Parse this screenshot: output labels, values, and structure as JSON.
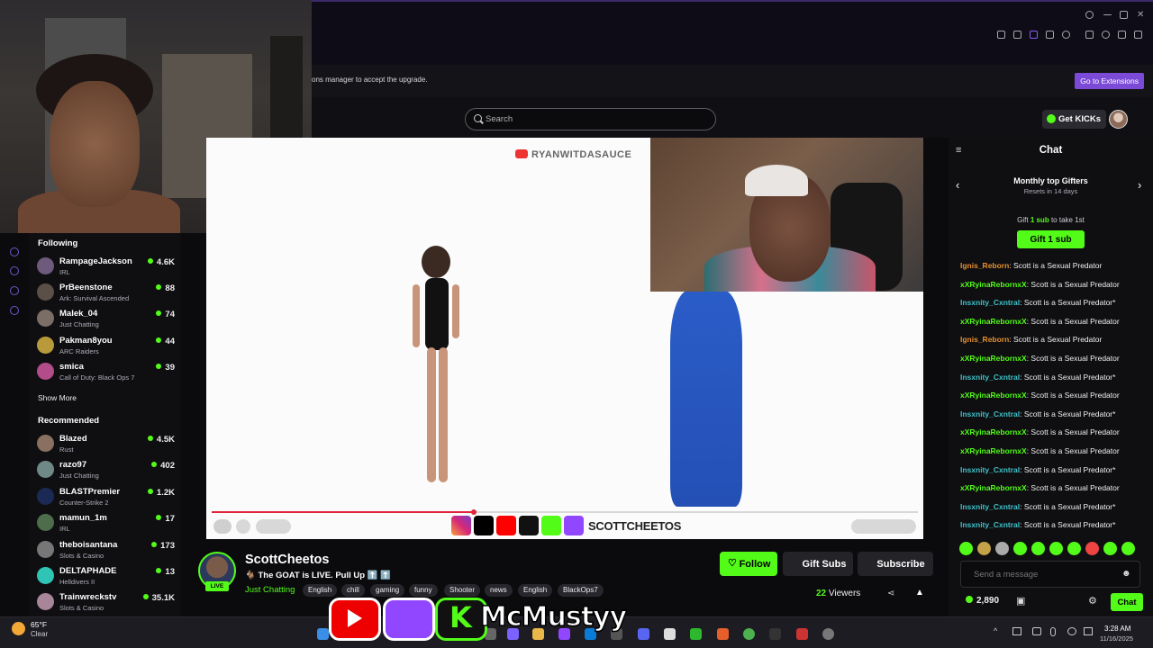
{
  "extension_bar": {
    "message": "ons manager to accept the upgrade.",
    "button_label": "Go to Extensions"
  },
  "header": {
    "search_placeholder": "Search",
    "get_kicks_label": "Get KICKs"
  },
  "sidebar": {
    "following_title": "Following",
    "following": [
      {
        "name": "RampageJackson",
        "category": "IRL",
        "viewers": "4.6K"
      },
      {
        "name": "PrBeenstone",
        "category": "Ark: Survival Ascended",
        "viewers": "88"
      },
      {
        "name": "Malek_04",
        "category": "Just Chatting",
        "viewers": "74"
      },
      {
        "name": "Pakman8you",
        "category": "ARC Raiders",
        "viewers": "44"
      },
      {
        "name": "smica",
        "category": "Call of Duty: Black Ops 7",
        "viewers": "39"
      }
    ],
    "show_more": "Show More",
    "recommended_title": "Recommended",
    "recommended": [
      {
        "name": "Blazed",
        "category": "Rust",
        "viewers": "4.5K"
      },
      {
        "name": "razo97",
        "category": "Just Chatting",
        "viewers": "402"
      },
      {
        "name": "BLASTPremier",
        "category": "Counter-Strike 2",
        "viewers": "1.2K"
      },
      {
        "name": "mamun_1m",
        "category": "IRL",
        "viewers": "17"
      },
      {
        "name": "theboisantana",
        "category": "Slots & Casino",
        "viewers": "173"
      },
      {
        "name": "DELTAPHADE",
        "category": "Helldivers II",
        "viewers": "13"
      },
      {
        "name": "Trainwreckstv",
        "category": "Slots & Casino",
        "viewers": "35.1K"
      }
    ]
  },
  "video": {
    "watermark": "RYANWITDASAUCE",
    "social_handle": "SCOTTCHEETOS",
    "progress_fraction": 0.37
  },
  "stream": {
    "streamer_name": "ScottCheetos",
    "title": "🐐 The GOAT is LIVE. Pull Up ⬆️ ⬆️",
    "category": "Just Chatting",
    "tags": [
      "English",
      "chill",
      "gaming",
      "funny",
      "Shooter",
      "news",
      "English",
      "BlackOps7"
    ],
    "live_label": "LIVE",
    "follow_label": "Follow",
    "gift_subs_label": "Gift Subs",
    "subscribe_label": "Subscribe",
    "viewers_count": "22",
    "viewers_label": "Viewers"
  },
  "chat": {
    "title": "Chat",
    "gifters_title": "Monthly top Gifters",
    "gifters_sub": "Resets in 14 days",
    "gift_note_pre": "Gift",
    "gift_note_highlight": "1 sub",
    "gift_note_post": "to take 1st",
    "gift_button": "Gift 1 sub",
    "messages": [
      {
        "user": "Ignis_Reborn",
        "color": "#e6902e",
        "text": ": Scott is a Sexual Predator"
      },
      {
        "user": "xXRyinaRebornxX",
        "color": "#53fc18",
        "text": ": Scott is a Sexual Predator"
      },
      {
        "user": "Insxnity_Cxntral",
        "color": "#3ec1c8",
        "text": ": Scott is a Sexual Predator*"
      },
      {
        "user": "xXRyinaRebornxX",
        "color": "#53fc18",
        "text": ": Scott is a Sexual Predator"
      },
      {
        "user": "Ignis_Reborn",
        "color": "#e6902e",
        "text": ": Scott is a Sexual Predator"
      },
      {
        "user": "xXRyinaRebornxX",
        "color": "#53fc18",
        "text": ": Scott is a Sexual Predator"
      },
      {
        "user": "Insxnity_Cxntral",
        "color": "#3ec1c8",
        "text": ": Scott is a Sexual Predator*"
      },
      {
        "user": "xXRyinaRebornxX",
        "color": "#53fc18",
        "text": ": Scott is a Sexual Predator"
      },
      {
        "user": "Insxnity_Cxntral",
        "color": "#3ec1c8",
        "text": ": Scott is a Sexual Predator*"
      },
      {
        "user": "xXRyinaRebornxX",
        "color": "#53fc18",
        "text": ": Scott is a Sexual Predator"
      },
      {
        "user": "xXRyinaRebornxX",
        "color": "#53fc18",
        "text": ": Scott is a Sexual Predator"
      },
      {
        "user": "Insxnity_Cxntral",
        "color": "#3ec1c8",
        "text": ": Scott is a Sexual Predator*"
      },
      {
        "user": "xXRyinaRebornxX",
        "color": "#53fc18",
        "text": ": Scott is a Sexual Predator"
      },
      {
        "user": "Insxnity_Cxntral",
        "color": "#3ec1c8",
        "text": ": Scott is a Sexual Predator*"
      },
      {
        "user": "Insxnity_Cxntral",
        "color": "#3ec1c8",
        "text": ": Scott is a Sexual Predator*"
      }
    ],
    "input_placeholder": "Send a message",
    "kicks_balance": "2,890",
    "send_label": "Chat"
  },
  "overlay": {
    "handle": "McMustyy"
  },
  "taskbar": {
    "temperature": "65°F",
    "weather": "Clear",
    "time": "3:28 AM",
    "date": "11/16/2025"
  },
  "colors": {
    "accent": "#53fc18",
    "extension_button": "#7b4bd8"
  }
}
